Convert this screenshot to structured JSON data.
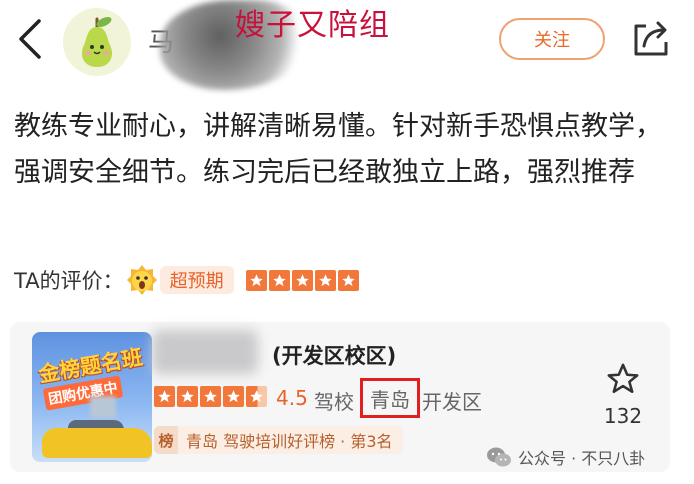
{
  "header": {
    "back_label": "<",
    "author_name": "马",
    "overlay_caption": "嫂子又陪组",
    "follow_label": "关注"
  },
  "review": {
    "text": "教练专业耐心，讲解清晰易懂。针对新手恐惧点教学，强调安全细节。练习完后已经敢独立上路，强烈推荐",
    "rating_label": "TA的评价：",
    "exceed_label": "超预期",
    "rating_stars": 5
  },
  "school_card": {
    "thumb_title": "金榜题名班",
    "thumb_subtitle": "团购优惠中",
    "name": "(开发区校区)",
    "score": "4.5",
    "rating_stars": 4.5,
    "type": "驾校",
    "city": "青岛",
    "area": "开发区",
    "rank_icon": "榜",
    "rank_text": "青岛 驾驶培训好评榜 · 第3名",
    "fav_count": "132"
  },
  "watermark": {
    "text": "公众号 · 不只八卦"
  },
  "colors": {
    "accent": "#e8632a",
    "star": "#f2773a",
    "highlight_box": "#e02020",
    "caption": "#c8123b"
  },
  "icons": [
    "back-icon",
    "pear-avatar-icon",
    "share-icon",
    "star-outline-icon",
    "wechat-icon",
    "surprised-emoji-icon"
  ]
}
